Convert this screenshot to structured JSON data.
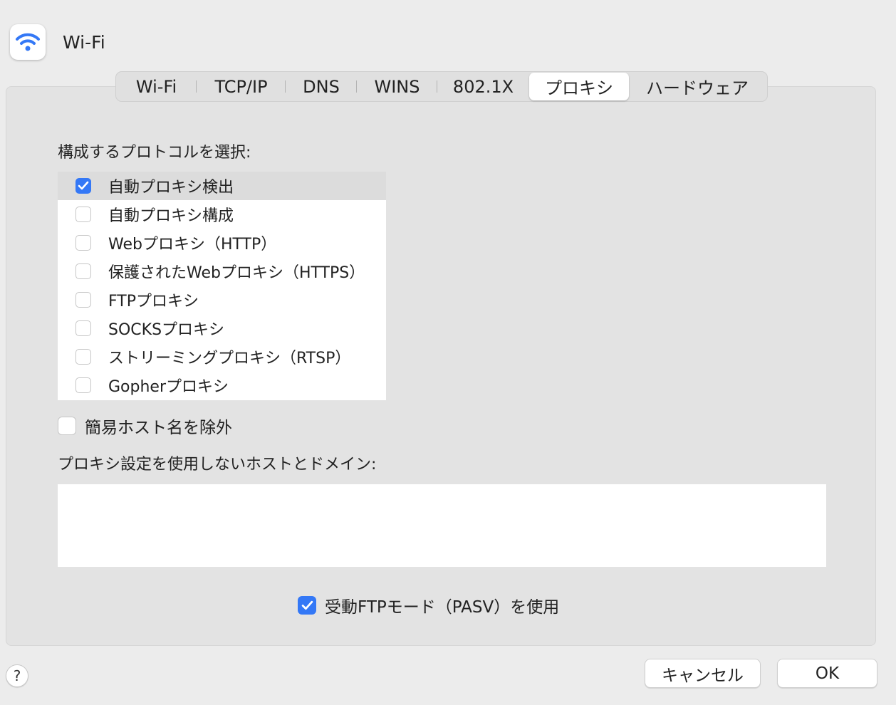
{
  "header": {
    "title": "Wi-Fi",
    "icon": "wifi-icon",
    "accent": "#3478f6"
  },
  "tabs": [
    {
      "label": "Wi-Fi",
      "active": false
    },
    {
      "label": "TCP/IP",
      "active": false
    },
    {
      "label": "DNS",
      "active": false
    },
    {
      "label": "WINS",
      "active": false
    },
    {
      "label": "802.1X",
      "active": false
    },
    {
      "label": "プロキシ",
      "active": true
    },
    {
      "label": "ハードウェア",
      "active": false
    }
  ],
  "proxy": {
    "protocols_label": "構成するプロトコルを選択:",
    "protocols": [
      {
        "label": "自動プロキシ検出",
        "checked": true,
        "selected": true
      },
      {
        "label": "自動プロキシ構成",
        "checked": false,
        "selected": false
      },
      {
        "label": "Webプロキシ（HTTP）",
        "checked": false,
        "selected": false
      },
      {
        "label": "保護されたWebプロキシ（HTTPS）",
        "checked": false,
        "selected": false
      },
      {
        "label": "FTPプロキシ",
        "checked": false,
        "selected": false
      },
      {
        "label": "SOCKSプロキシ",
        "checked": false,
        "selected": false
      },
      {
        "label": "ストリーミングプロキシ（RTSP）",
        "checked": false,
        "selected": false
      },
      {
        "label": "Gopherプロキシ",
        "checked": false,
        "selected": false
      }
    ],
    "exclude_simple": {
      "label": "簡易ホスト名を除外",
      "checked": false
    },
    "bypass_label": "プロキシ設定を使用しないホストとドメイン:",
    "bypass_value": "",
    "pasv": {
      "label": "受動FTPモード（PASV）を使用",
      "checked": true
    }
  },
  "footer": {
    "help": "?",
    "cancel": "キャンセル",
    "ok": "OK"
  }
}
